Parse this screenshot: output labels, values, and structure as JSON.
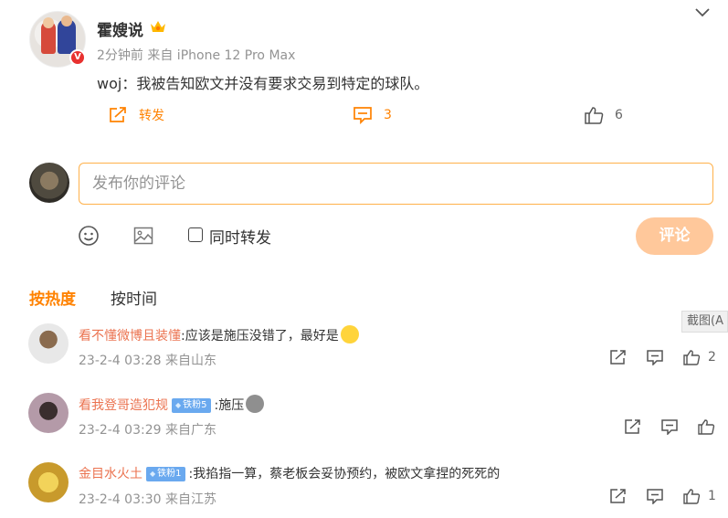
{
  "post": {
    "author": "霍嫂说",
    "meta": "2分钟前 来自 iPhone 12 Pro Max",
    "text": "woj：我被告知欧文并没有要求交易到特定的球队。",
    "verified_badge": "V",
    "actions": {
      "repost_label": "转发",
      "comment_count": "3",
      "like_count": "6"
    }
  },
  "composer": {
    "placeholder": "发布你的评论",
    "share_label": "同时转发",
    "submit_label": "评论"
  },
  "sort_tabs": {
    "hot": "按热度",
    "time": "按时间"
  },
  "screenshot_tip": "截图(A",
  "comments": [
    {
      "name": "看不懂微博且装懂",
      "fan_badge": "",
      "text": ":应该是施压没错了，最好是",
      "time": "23-2-4 03:28 来自山东",
      "like_count": "2"
    },
    {
      "name": "看我登哥造犯规",
      "fan_badge": "铁粉5",
      "text": ":施压",
      "time": "23-2-4 03:29 来自广东",
      "like_count": ""
    },
    {
      "name": "金目水火土",
      "fan_badge": "铁粉1",
      "text": ":我掐指一算，蔡老板会妥协预约，被欧文拿捏的死死的",
      "time": "23-2-4 03:30 来自江苏",
      "like_count": "1"
    }
  ],
  "icons": {
    "chevron": "chevron-down-icon",
    "repost": "repost-icon",
    "comment": "comment-icon",
    "like": "thumbs-up-icon",
    "emoji": "emoji-icon",
    "image": "image-icon",
    "share": "share-icon"
  },
  "colors": {
    "accent": "#ff8200",
    "username": "#eb7350",
    "meta": "#939393",
    "submit_bg": "#ffc89b",
    "input_border": "#ffb14a",
    "fan_badge": "#6aa9ef",
    "verified_red": "#e8312f"
  }
}
